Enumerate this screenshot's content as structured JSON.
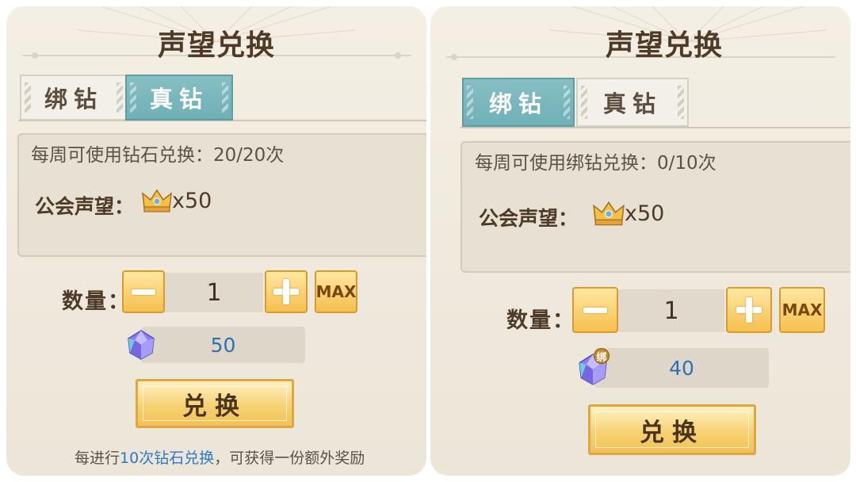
{
  "panels": [
    {
      "title": "声望兑换",
      "tabs": [
        {
          "label": "绑钻",
          "active": false
        },
        {
          "label": "真钻",
          "active": true
        }
      ],
      "weekly_limit": "每周可使用钻石兑换：20/20次",
      "reputation_label": "公会声望：",
      "reputation_amount": "x50",
      "quantity_label": "数量：",
      "quantity_value": "1",
      "max_label": "MAX",
      "cost_value": "50",
      "exchange_label": "兑换",
      "footer": {
        "prefix": "每进行",
        "highlight": "10次钻石兑换",
        "suffix": "，可获得一份额外奖励"
      }
    },
    {
      "title": "声望兑换",
      "tabs": [
        {
          "label": "绑钻",
          "active": true
        },
        {
          "label": "真钻",
          "active": false
        }
      ],
      "weekly_limit": "每周可使用绑钻兑换：0/10次",
      "reputation_label": "公会声望：",
      "reputation_amount": "x50",
      "quantity_label": "数量：",
      "quantity_value": "1",
      "max_label": "MAX",
      "cost_value": "40",
      "cost_badge": "绑",
      "exchange_label": "兑换"
    }
  ],
  "icons": {
    "crown": "crown-icon",
    "gem": "diamond-gem-icon"
  },
  "colors": {
    "active_tab": "#7ab6bc",
    "gold_button": "#f5c04f",
    "highlight_text": "#2e79c4",
    "cost_text": "#2e6fb5"
  }
}
